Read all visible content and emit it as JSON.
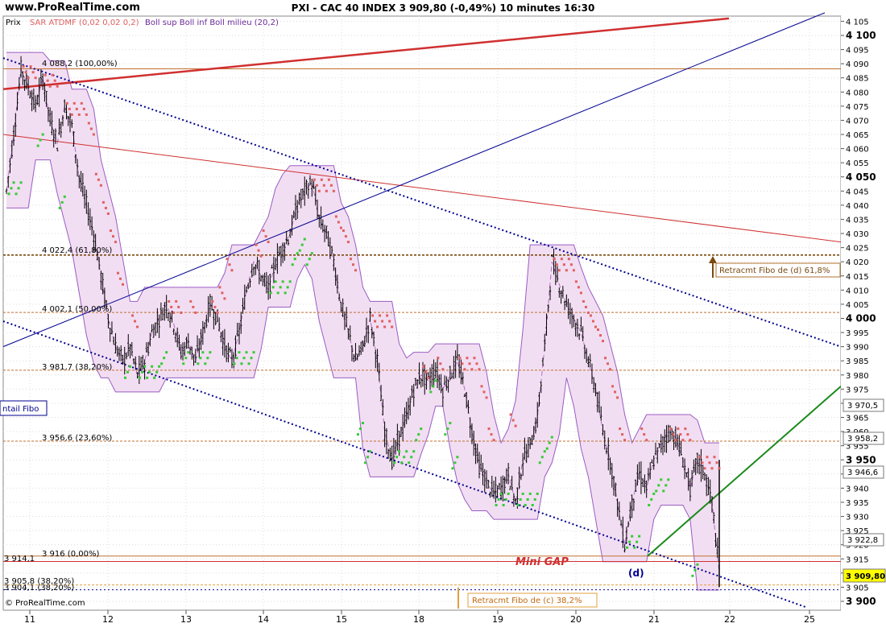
{
  "header": {
    "site": "www.ProRealTime.com",
    "title": "PXI - CAC 40 INDEX     3 909,80 (-0,49%)     10 minutes  16:30"
  },
  "legend": {
    "prix": "Prix",
    "sar": "SAR ATDMF (0,02 0,02 0,2)",
    "boll": "Boll sup Boll inf Boll milieu (20,2)"
  },
  "footer": "© ProRealTime.com",
  "labels": {
    "mini_gap": "Mini GAP",
    "d": "(d)",
    "fibo_d": "Retracmt Fibo de (d) 61,8%",
    "fibo_c": "Retracmt Fibo de (c) 38,2%",
    "detail_fibo": "ntail Fibo",
    "fib_100": "4 088,2 (100,00%)",
    "fib_618": "4 022,4 (61,80%)",
    "fib_50": "4 002,1 (50,00%)",
    "fib_382": "3 981,7 (38,20%)",
    "fib_236": "3 956,6 (23,60%)",
    "fib_0": "3 916 (0,00%)",
    "fib_left": "3 914,1",
    "fib_c1": "3 905,8 (38,20%)",
    "fib_c2": "3 904,1 (38,20%)",
    "highlight_a": "3 970,5",
    "highlight_b": "3 958,2",
    "highlight_c": "3 946,6",
    "highlight_d": "3 922,8",
    "last_price": "3 909,80"
  },
  "colors": {
    "candle": "#000000",
    "sar_up": "#33cc33",
    "sar_down": "#e06060",
    "bollinger_fill": "#f0d8f0",
    "bollinger_line": "#9a5cc4",
    "trend_blue": "#000090",
    "trend_red": "#d03030",
    "trend_green": "#1a8a1a",
    "fibo_line": "#b07030",
    "last_price_box": "#ffff00"
  },
  "chart_data": {
    "type": "candlestick",
    "title": "PXI - CAC 40 INDEX",
    "timeframe": "10 minutes",
    "last": 3909.8,
    "change_pct": -0.49,
    "ylim": [
      3898,
      4110
    ],
    "y_ticks": [
      4105,
      4100,
      4095,
      4090,
      4085,
      4080,
      4075,
      4070,
      4065,
      4060,
      4055,
      4050,
      4045,
      4040,
      4035,
      4030,
      4025,
      4020,
      4015,
      4010,
      4005,
      4000,
      3995,
      3990,
      3985,
      3980,
      3975,
      3970,
      3965,
      3960,
      3955,
      3950,
      3945,
      3940,
      3935,
      3930,
      3925,
      3920,
      3915,
      3910,
      3905,
      3900
    ],
    "y_tick_labels": [
      "4 105",
      "4 100",
      "4 095",
      "4 090",
      "4 085",
      "4 080",
      "4 075",
      "4 070",
      "4 065",
      "4 060",
      "4 055",
      "4 050",
      "4 045",
      "4 040",
      "4 035",
      "4 030",
      "4 025",
      "4 020",
      "4 015",
      "4 010",
      "4 005",
      "4 000",
      "3 995",
      "3 990",
      "3 985",
      "3 980",
      "3 975",
      "3 970",
      "3 965",
      "3 960",
      "3 955",
      "3 950",
      "3 945",
      "3 940",
      "3 935",
      "3 930",
      "3 925",
      "3 920",
      "3 915",
      "3 910",
      "3 905",
      "3 900"
    ],
    "bold_ticks": [
      4100,
      4050,
      4000,
      3950,
      3900
    ],
    "x_tick_labels": [
      "11",
      "12",
      "13",
      "14",
      "15",
      "18",
      "19",
      "20",
      "21",
      "22",
      "25"
    ],
    "close_path": [
      4045,
      4065,
      4088,
      4082,
      4075,
      4085,
      4070,
      4062,
      4075,
      4068,
      4050,
      4040,
      4030,
      4015,
      4000,
      3990,
      3985,
      3990,
      3980,
      3985,
      3995,
      4000,
      4005,
      3998,
      3988,
      3992,
      3985,
      3995,
      4005,
      4000,
      3990,
      3985,
      3995,
      4010,
      4020,
      4015,
      4010,
      4020,
      4025,
      4030,
      4040,
      4045,
      4048,
      4035,
      4030,
      4020,
      4005,
      3995,
      3985,
      3990,
      4000,
      3985,
      3960,
      3950,
      3958,
      3965,
      3975,
      3980,
      3978,
      3982,
      3975,
      3980,
      3985,
      3975,
      3960,
      3948,
      3942,
      3938,
      3940,
      3945,
      3935,
      3950,
      3955,
      3965,
      3990,
      4020,
      4012,
      4005,
      4000,
      3995,
      3985,
      3975,
      3960,
      3950,
      3935,
      3920,
      3935,
      3945,
      3940,
      3950,
      3955,
      3960,
      3958,
      3950,
      3940,
      3950,
      3945,
      3935,
      3910
    ],
    "fibonacci_levels": [
      {
        "label": "100,00%",
        "value": 4088.2
      },
      {
        "label": "61,80%",
        "value": 4022.4
      },
      {
        "label": "50,00%",
        "value": 4002.1
      },
      {
        "label": "38,20%",
        "value": 3981.7
      },
      {
        "label": "23,60%",
        "value": 3956.6
      },
      {
        "label": "0,00%",
        "value": 3916
      }
    ],
    "highlighted_prices": [
      3970.5,
      3958.2,
      3946.6,
      3922.8,
      3909.8
    ]
  }
}
